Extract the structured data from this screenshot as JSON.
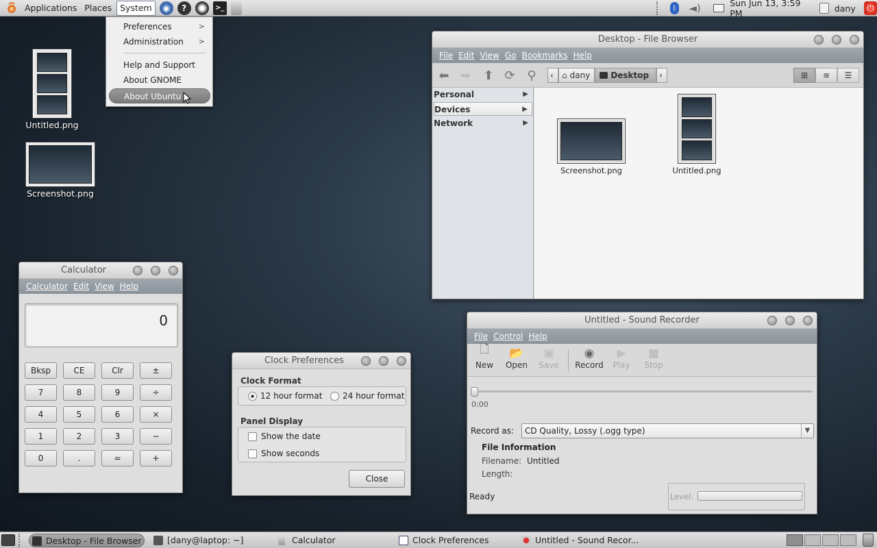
{
  "top_panel": {
    "menus": [
      "Applications",
      "Places",
      "System"
    ],
    "clock": "Sun Jun 13,  3:59 PM",
    "user": "dany"
  },
  "system_menu": {
    "items": [
      "Preferences",
      "Administration",
      "Help and Support",
      "About GNOME",
      "About Ubuntu"
    ],
    "submenu_arrow": ">"
  },
  "desktop_icons": [
    {
      "label": "Untitled.png"
    },
    {
      "label": "Screenshot.png"
    }
  ],
  "file_browser": {
    "title": "Desktop - File Browser",
    "menu": [
      "File",
      "Edit",
      "View",
      "Go",
      "Bookmarks",
      "Help"
    ],
    "breadcrumbs": [
      "dany",
      "Desktop"
    ],
    "sidebar": [
      "Personal",
      "Devices",
      "Network"
    ],
    "files": [
      {
        "name": "Screenshot.png"
      },
      {
        "name": "Untitled.png"
      }
    ]
  },
  "calculator": {
    "title": "Calculator",
    "menu": [
      "Calculator",
      "Edit",
      "View",
      "Help"
    ],
    "display": "0",
    "buttons": [
      [
        "Bksp",
        "CE",
        "Clr",
        "±"
      ],
      [
        "7",
        "8",
        "9",
        "÷"
      ],
      [
        "4",
        "5",
        "6",
        "×"
      ],
      [
        "1",
        "2",
        "3",
        "−"
      ],
      [
        "0",
        ".",
        "=",
        "+"
      ]
    ]
  },
  "clock_prefs": {
    "title": "Clock Preferences",
    "clock_format_label": "Clock Format",
    "option_12": "12 hour format",
    "option_24": "24 hour format",
    "selected_format": "12 hour format",
    "panel_display_label": "Panel Display",
    "show_date": "Show the date",
    "show_seconds": "Show seconds",
    "close": "Close"
  },
  "sound_recorder": {
    "title": "Untitled - Sound Recorder",
    "menu": [
      "File",
      "Control",
      "Help"
    ],
    "tools": [
      "New",
      "Open",
      "Save",
      "Record",
      "Play",
      "Stop"
    ],
    "time": "0:00",
    "record_as_label": "Record as:",
    "record_as_value": "CD Quality, Lossy (.ogg type)",
    "file_info_heading": "File Information",
    "filename_label": "Filename:",
    "filename_value": "Untitled",
    "length_label": "Length:",
    "status": "Ready",
    "level_label": "Level:"
  },
  "taskbar": {
    "tasks": [
      "Desktop - File Browser",
      "[dany@laptop: ~]",
      "Calculator",
      "Clock Preferences",
      "Untitled - Sound Recor..."
    ]
  },
  "colors": {
    "desktop": "#2b3a48",
    "menubar": "#939ba3",
    "selection": "#7f7f7f",
    "power": "#d42a1e"
  }
}
